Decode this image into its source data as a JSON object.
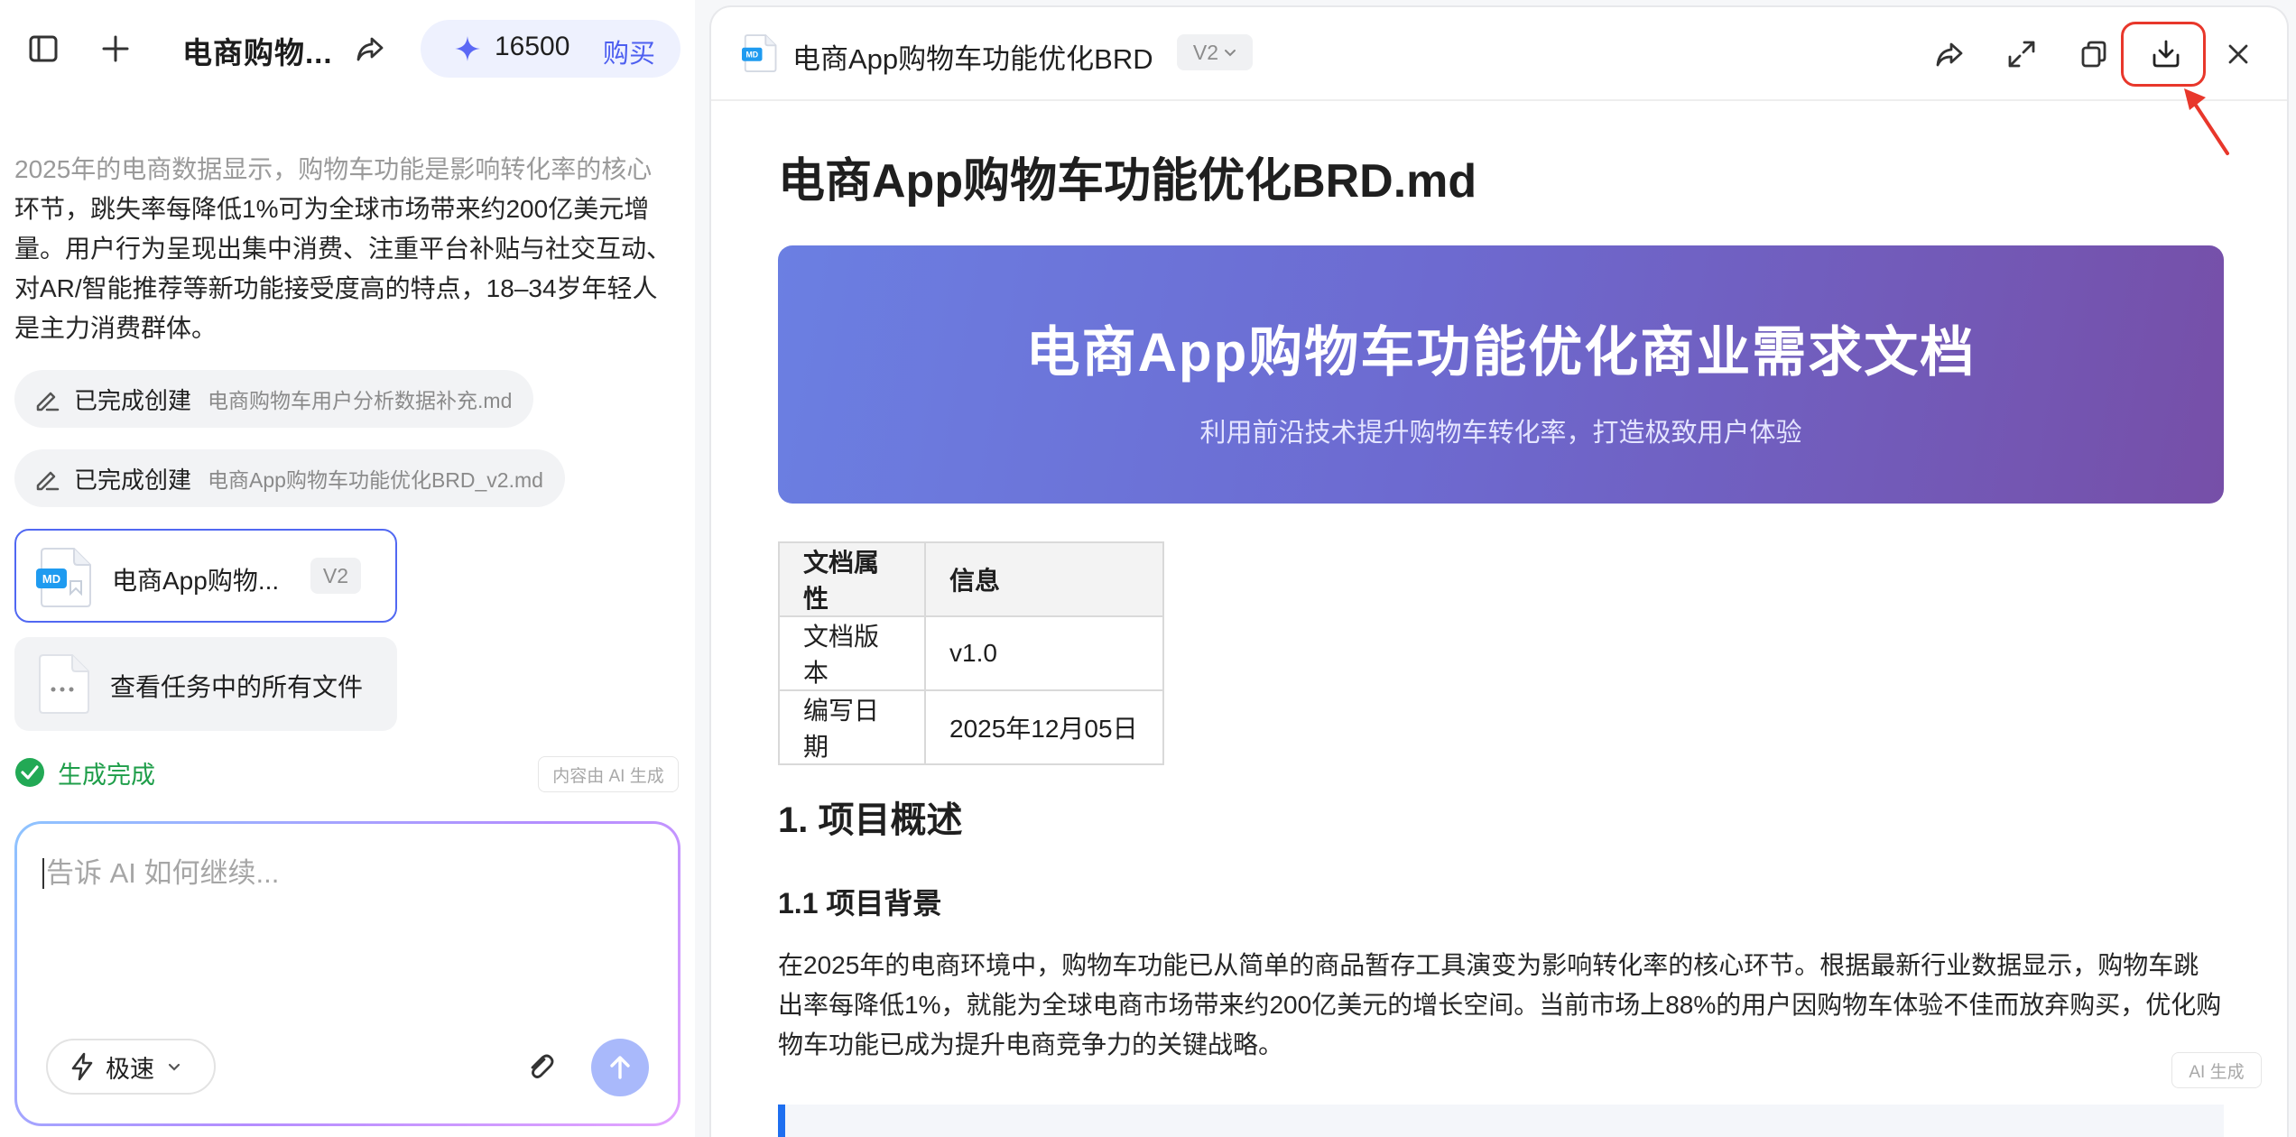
{
  "colors": {
    "accent": "#4d5ff0",
    "highlight": "#e8372b",
    "success": "#1f9e4a",
    "hero_start": "#6b7fe2",
    "hero_end": "#764fa8"
  },
  "left": {
    "topbar": {
      "chat_title": "电商购物...",
      "credits": "16500",
      "buy_label": "购买"
    },
    "message": {
      "faded_text": "2025年的电商数据显示，购物车功能是影响转化率的核心",
      "line2": "环节，跳失率每降低1%可为全球市场带来约200亿美元增",
      "line3": "量。用户行为呈现出集中消费、注重平台补贴与社交互动、",
      "line4": "对AR/智能推荐等新功能接受度高的特点，18–34岁年轻人",
      "line5": "是主力消费群体。"
    },
    "created_items": [
      {
        "label": "已完成创建",
        "file": "电商购物车用户分析数据补充.md"
      },
      {
        "label": "已完成创建",
        "file": "电商App购物车功能优化BRD_v2.md"
      }
    ],
    "file_card": {
      "name": "电商App购物...",
      "version": "V2",
      "icon": "md-file-icon"
    },
    "all_files_label": "查看任务中的所有文件",
    "status_text": "生成完成",
    "ai_note": "内容由 AI 生成",
    "input": {
      "placeholder": "告诉 AI 如何继续...",
      "mode_label": "极速"
    }
  },
  "doc": {
    "header_title": "电商App购物车功能优化BRD",
    "version": "V2",
    "h1": "电商App购物车功能优化BRD.md",
    "hero_title": "电商App购物车功能优化商业需求文档",
    "hero_subtitle": "利用前沿技术提升购物车转化率，打造极致用户体验",
    "table": {
      "headers": [
        "文档属性",
        "信息"
      ],
      "rows": [
        [
          "文档版本",
          "v1.0"
        ],
        [
          "编写日期",
          "2025年12月05日"
        ]
      ]
    },
    "h2": "1. 项目概述",
    "h3": "1.1 项目背景",
    "paragraph": "在2025年的电商环境中，购物车功能已从简单的商品暂存工具演变为影响转化率的核心环节。根据最新行业数据显示，购物车跳出率每降低1%，就能为全球电商市场带来约200亿美元的增长空间。当前市场上88%的用户因购物车体验不佳而放弃购买，优化购物车功能已成为提升电商竞争力的关键战略。",
    "ai_badge": "AI 生成"
  }
}
